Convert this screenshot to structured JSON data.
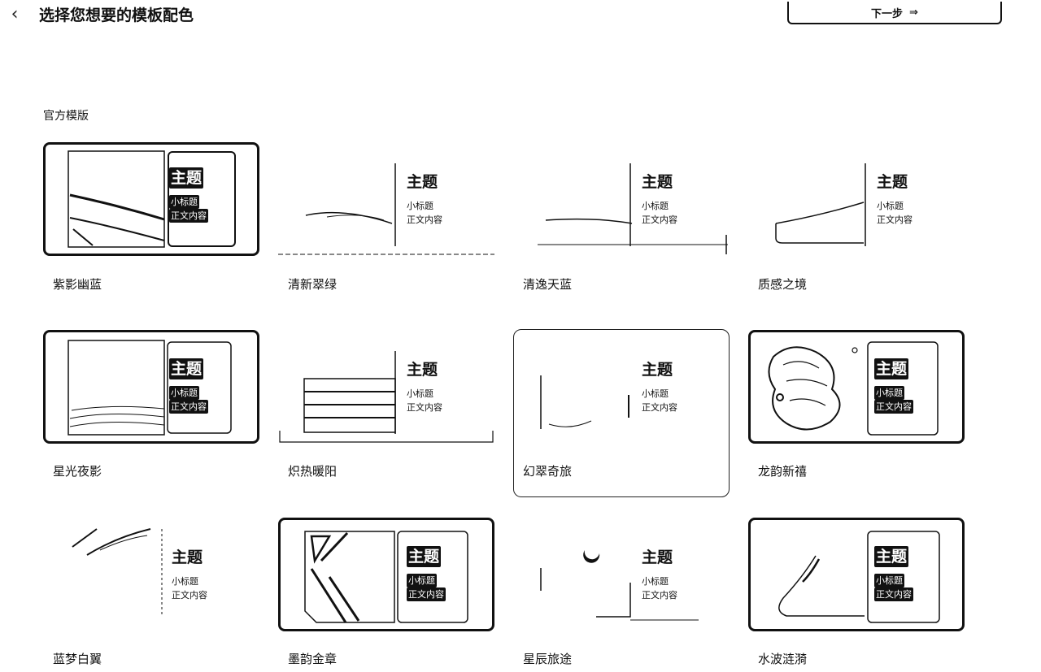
{
  "header": {
    "back_icon": "chevron-left-icon",
    "title": "选择您想要的模板配色",
    "next_label": "下一步",
    "next_icon": "double-arrow-right-icon"
  },
  "section_label": "官方模版",
  "templates": [
    {
      "name": "紫影幽蓝",
      "style": "heavy",
      "main": "主题",
      "sub": "小标题",
      "body": "正文内容"
    },
    {
      "name": "清新翠绿",
      "style": "plain",
      "main": "主题",
      "sub": "小标题",
      "body": "正文内容"
    },
    {
      "name": "清逸天蓝",
      "style": "plain",
      "main": "主题",
      "sub": "小标题",
      "body": "正文内容"
    },
    {
      "name": "质感之境",
      "style": "plain",
      "main": "主题",
      "sub": "小标题",
      "body": "正文内容"
    },
    {
      "name": "星光夜影",
      "style": "heavy",
      "main": "主题",
      "sub": "小标题",
      "body": "正文内容"
    },
    {
      "name": "炽热暖阳",
      "style": "plain",
      "main": "主题",
      "sub": "小标题",
      "body": "正文内容"
    },
    {
      "name": "幻翠奇旅",
      "style": "plain",
      "selected": true,
      "main": "主题",
      "sub": "小标题",
      "body": "正文内容"
    },
    {
      "name": "龙韵新禧",
      "style": "heavy",
      "main": "主题",
      "sub": "小标题",
      "body": "正文内容"
    },
    {
      "name": "蓝梦白翼",
      "style": "plain",
      "main": "主题",
      "sub": "小标题",
      "body": "正文内容"
    },
    {
      "name": "墨韵金章",
      "style": "heavy",
      "main": "主题",
      "sub": "小标题",
      "body": "正文内容"
    },
    {
      "name": "星辰旅途",
      "style": "plain",
      "main": "主题",
      "sub": "小标题",
      "body": "正文内容"
    },
    {
      "name": "水波涟漪",
      "style": "heavy",
      "main": "主题",
      "sub": "小标题",
      "body": "正文内容"
    }
  ],
  "colors": {
    "ink": "#111111",
    "background": "#ffffff"
  }
}
